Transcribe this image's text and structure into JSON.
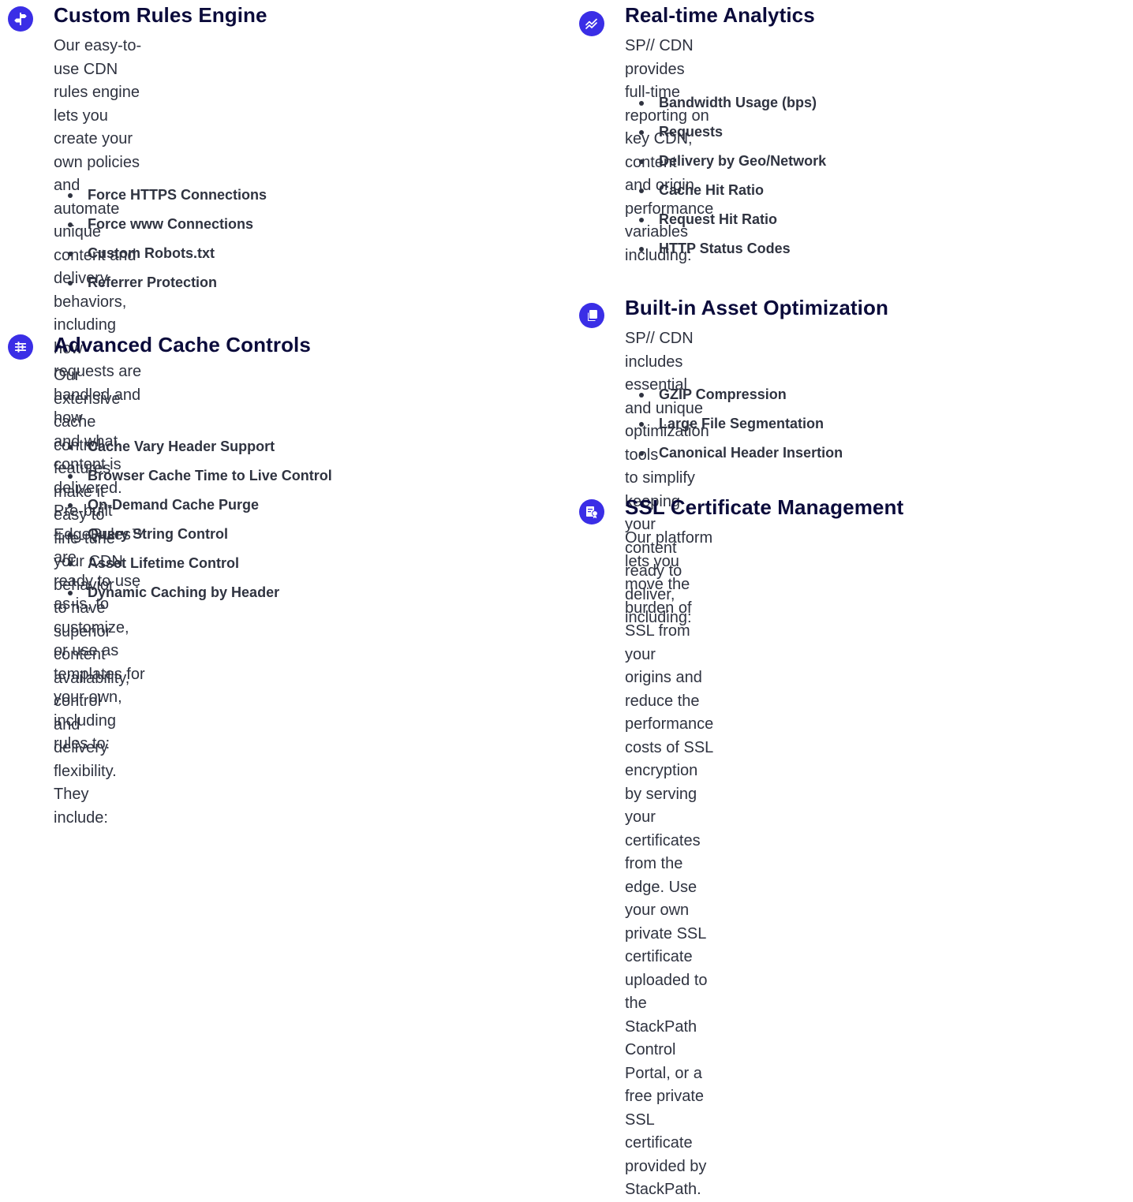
{
  "left_column": {
    "custom_rules": {
      "icon": "signpost-icon",
      "title": "Custom Rules Engine",
      "description_lines": [
        "Our easy-to-use CDN rules engine lets you create your",
        "own policies and automate unique content and delivery",
        "behaviors, including how requests are handled and how",
        "and what content is delivered. Pre-built EdgeRules™ are",
        "ready to use as-is, to customize, or use as templates for",
        "your own, including rules to:"
      ],
      "items": [
        "Force HTTPS Connections",
        "Force www Connections",
        "Custom Robots.txt",
        "Referrer Protection"
      ]
    },
    "cache_controls": {
      "icon": "sliders-icon",
      "title": "Advanced Cache Controls",
      "description_lines": [
        "Our extensive cache control features make it easy to",
        "fine-tune your CDN behavior to have superior content",
        "availability, control and delivery flexibility. They include:"
      ],
      "items": [
        "Cache Vary Header Support",
        "Browser Cache Time to Live Control",
        "On-Demand Cache Purge",
        "Query String Control",
        "Asset Lifetime Control",
        "Dynamic Caching by Header"
      ]
    }
  },
  "right_column": {
    "analytics": {
      "icon": "analytics-chart-icon",
      "title": "Real-time Analytics",
      "description_lines": [
        "SP// CDN provides full-time reporting on key CDN, content",
        "and origin performance variables including:"
      ],
      "items": [
        "Bandwidth Usage (bps)",
        "Requests",
        "Delivery by Geo/Network",
        "Cache Hit Ratio",
        "Request Hit Ratio",
        "HTTP Status Codes"
      ]
    },
    "asset_optimization": {
      "icon": "stacked-pages-icon",
      "title": "Built-in Asset Optimization",
      "description_lines": [
        "SP// CDN includes essential and unique optimization tools",
        "to simplify keeping your content ready to deliver, including:"
      ],
      "items": [
        "GZIP Compression",
        "Large File Segmentation",
        "Canonical Header Insertion"
      ]
    },
    "ssl_management": {
      "icon": "certificate-icon",
      "title": "SSL Certificate Management",
      "description_lines": [
        "Our platform lets you move the burden of SSL from your",
        "origins and reduce the performance costs of SSL encryption",
        "by serving your certificates from the edge. Use your own",
        "private SSL certificate uploaded to the StackPath Control",
        "Portal, or a free private SSL certificate provided by StackPath."
      ]
    }
  },
  "colors": {
    "icon_background": "#3a2ee6",
    "heading": "#0b0b3b",
    "body_text": "#2f3340"
  }
}
